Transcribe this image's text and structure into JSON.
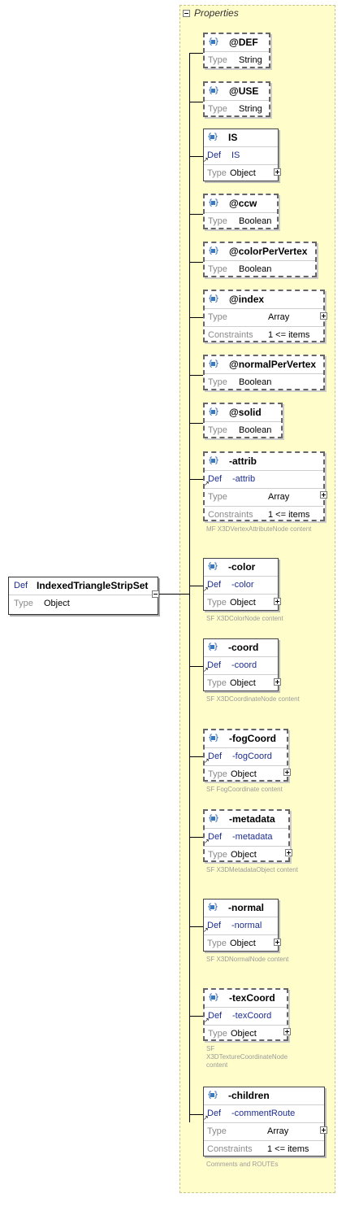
{
  "panel_title": "Properties",
  "root": {
    "def_label": "Def",
    "name": "IndexedTriangleStripSet",
    "type_label": "Type",
    "type_value": "Object"
  },
  "items": [
    {
      "name": "@DEF",
      "rows": [
        {
          "label": "Type",
          "value": "String"
        }
      ]
    },
    {
      "name": "@USE",
      "rows": [
        {
          "label": "Type",
          "value": "String"
        }
      ]
    },
    {
      "name": "IS",
      "rows": [
        {
          "label": "Def",
          "value": "IS"
        },
        {
          "label": "Type",
          "value": "Object"
        }
      ]
    },
    {
      "name": "@ccw",
      "rows": [
        {
          "label": "Type",
          "value": "Boolean"
        }
      ]
    },
    {
      "name": "@colorPerVertex",
      "rows": [
        {
          "label": "Type",
          "value": "Boolean"
        }
      ]
    },
    {
      "name": "@index",
      "rows": [
        {
          "label": "Type",
          "value": "Array"
        },
        {
          "label": "Constraints",
          "value": "1 <= items"
        }
      ]
    },
    {
      "name": "@normalPerVertex",
      "rows": [
        {
          "label": "Type",
          "value": "Boolean"
        }
      ]
    },
    {
      "name": "@solid",
      "rows": [
        {
          "label": "Type",
          "value": "Boolean"
        }
      ]
    },
    {
      "name": "-attrib",
      "rows": [
        {
          "label": "Def",
          "value": "-attrib"
        },
        {
          "label": "Type",
          "value": "Array"
        },
        {
          "label": "Constraints",
          "value": "1 <= items"
        }
      ],
      "note": "MF X3DVertexAttributeNode content"
    },
    {
      "name": "-color",
      "rows": [
        {
          "label": "Def",
          "value": "-color"
        },
        {
          "label": "Type",
          "value": "Object"
        }
      ],
      "note": "SF X3DColorNode content"
    },
    {
      "name": "-coord",
      "rows": [
        {
          "label": "Def",
          "value": "-coord"
        },
        {
          "label": "Type",
          "value": "Object"
        }
      ],
      "note": "SF X3DCoordinateNode content"
    },
    {
      "name": "-fogCoord",
      "rows": [
        {
          "label": "Def",
          "value": "-fogCoord"
        },
        {
          "label": "Type",
          "value": "Object"
        }
      ],
      "note": "SF FogCoordinate content"
    },
    {
      "name": "-metadata",
      "rows": [
        {
          "label": "Def",
          "value": "-metadata"
        },
        {
          "label": "Type",
          "value": "Object"
        }
      ],
      "note": "SF X3DMetadataObject content"
    },
    {
      "name": "-normal",
      "rows": [
        {
          "label": "Def",
          "value": "-normal"
        },
        {
          "label": "Type",
          "value": "Object"
        }
      ],
      "note": "SF X3DNormalNode content"
    },
    {
      "name": "-texCoord",
      "rows": [
        {
          "label": "Def",
          "value": "-texCoord"
        },
        {
          "label": "Type",
          "value": "Object"
        }
      ],
      "note": "SF X3DTextureCoordinateNode content"
    },
    {
      "name": "-children",
      "rows": [
        {
          "label": "Def",
          "value": "-commentRoute"
        },
        {
          "label": "Type",
          "value": "Array"
        },
        {
          "label": "Constraints",
          "value": "1 <= items"
        }
      ],
      "note": "Comments and ROUTEs"
    }
  ]
}
